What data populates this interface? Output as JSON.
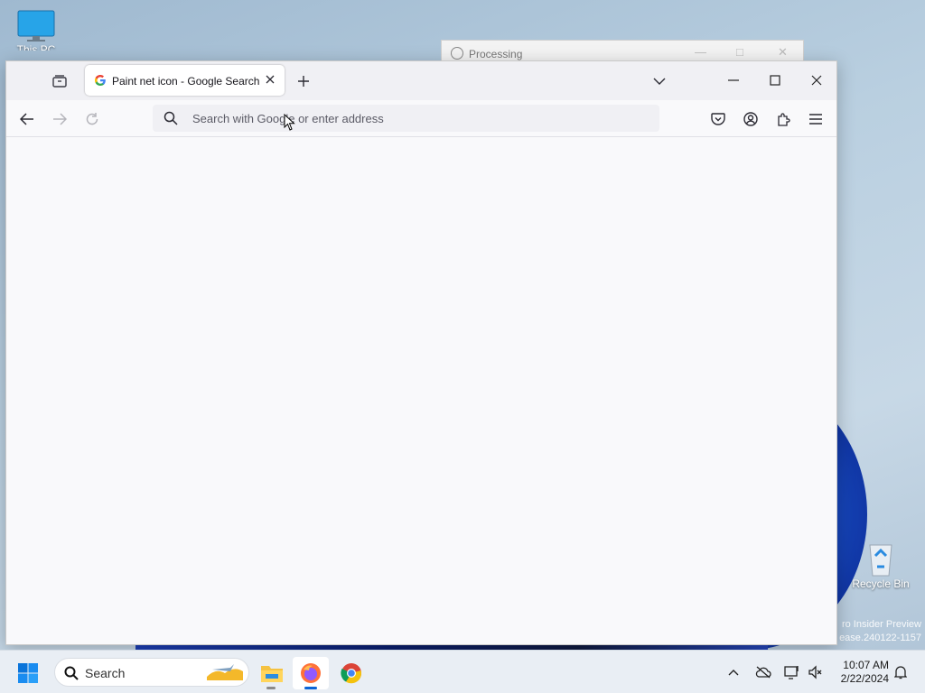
{
  "desktop": {
    "this_pc_label": "This PC",
    "recycle_bin_label": "Recycle Bin",
    "watermark_line1": "ro Insider Preview",
    "watermark_line2": "ease.240122-1157"
  },
  "background_window": {
    "title": "Processing"
  },
  "browser": {
    "tab": {
      "title": "Paint net icon - Google Search",
      "favicon": "google-g-icon"
    },
    "new_tab_label": "+",
    "urlbar": {
      "value": "",
      "placeholder": "Search with Google or enter address"
    },
    "toolbar_icons": [
      "back-icon",
      "forward-icon",
      "reload-icon",
      "pocket-icon",
      "account-icon",
      "extensions-icon",
      "menu-icon"
    ],
    "window_controls": [
      "minimize-icon",
      "maximize-icon",
      "close-icon"
    ]
  },
  "taskbar": {
    "search_label": "Search",
    "apps": [
      "file-explorer-icon",
      "firefox-icon",
      "chrome-icon"
    ],
    "time": "10:07 AM",
    "date": "2/22/2024"
  },
  "colors": {
    "accent": "#0a64d6",
    "tab_bg": "#ffffff",
    "tabbar_bg": "#f0f0f4"
  }
}
